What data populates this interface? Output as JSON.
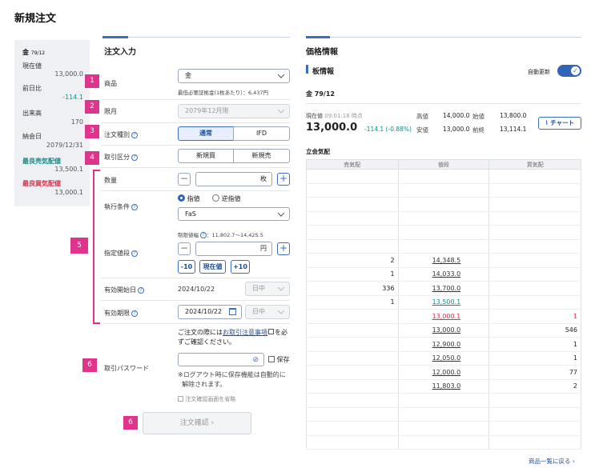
{
  "page_title": "新規注文",
  "summary": {
    "product": "金",
    "product_month": "79/12",
    "rows": [
      {
        "label": "現在値",
        "value": "13,000.0"
      },
      {
        "label": "前日比",
        "value": "-114.1"
      },
      {
        "label": "出来高",
        "value": "170"
      },
      {
        "label": "納会日",
        "value": "2079/12/31"
      },
      {
        "label": "最良売気配値",
        "value": "13,500.1"
      },
      {
        "label": "最良買気配値",
        "value": "13,000.1"
      }
    ]
  },
  "order_form": {
    "section_title": "注文入力",
    "product_label": "商品",
    "product_value": "金",
    "margin_note": "最低必要証拠金(1枚あたり）：6,437円",
    "month_label": "限月",
    "month_value": "2079年12月限",
    "order_type_label": "注文種別",
    "order_type_options": [
      "通常",
      "IFD"
    ],
    "trade_type_label": "取引区分",
    "trade_type_options": [
      "新規買",
      "新規売"
    ],
    "quantity_label": "数量",
    "quantity_unit": "枚",
    "exec_label": "執行条件",
    "exec_radio_1": "指値",
    "exec_radio_2": "逆指値",
    "exec_select": "FaS",
    "limit_range": "制限値幅",
    "limit_range_value": "：11,802.7〜14,425.5",
    "price_label": "指定値段",
    "price_unit": "円",
    "tick_minus": "-10",
    "tick_current": "現在値",
    "tick_plus": "+10",
    "start_label": "有効開始日",
    "start_date": "2024/10/22",
    "start_session": "日中",
    "end_label": "有効期限",
    "end_date": "2024/10/22",
    "end_session": "日中",
    "notice_pre": "ご注文の際には",
    "notice_link": "お取引注意事項",
    "notice_post": "を必",
    "notice_line2": "ずご確認ください。",
    "password_label": "取引パスワード",
    "save_label": "保存",
    "logout_note_1": "※ログアウト時に保存機能は自動的に",
    "logout_note_2": "解除されます。",
    "skip_confirm": "注文確認画面を省略",
    "confirm_button": "注文確認",
    "markers": [
      "1",
      "2",
      "3",
      "4",
      "5",
      "6",
      "6"
    ]
  },
  "price_info": {
    "section_title": "価格情報",
    "board_title": "板情報",
    "auto_update": "自動更新",
    "product": "金 79/12",
    "current_label": "現在値",
    "current_time": "09:01:18 時点",
    "current_price": "13,000.0",
    "change": "-114.1 (-0.88%)",
    "high_label": "高値",
    "high": "14,000.0",
    "open_label": "始値",
    "open": "13,800.0",
    "low_label": "安値",
    "low": "13,000.0",
    "prev_label": "前終",
    "prev": "13,114.1",
    "chart_button": "チャート",
    "auction_title": "立会気配",
    "columns": [
      "売気配",
      "値段",
      "買気配"
    ],
    "book": [
      {
        "sell": "",
        "price": "",
        "buy": ""
      },
      {
        "sell": "",
        "price": "",
        "buy": ""
      },
      {
        "sell": "",
        "price": "",
        "buy": ""
      },
      {
        "sell": "",
        "price": "",
        "buy": ""
      },
      {
        "sell": "",
        "price": "",
        "buy": ""
      },
      {
        "sell": "",
        "price": "",
        "buy": ""
      },
      {
        "sell": "2",
        "price": "14,348.5",
        "buy": ""
      },
      {
        "sell": "1",
        "price": "14,033.0",
        "buy": ""
      },
      {
        "sell": "336",
        "price": "13,700.0",
        "buy": ""
      },
      {
        "sell": "1",
        "price": "13,500.1",
        "buy": ""
      },
      {
        "sell": "",
        "price": "13,000.1",
        "buy": "1"
      },
      {
        "sell": "",
        "price": "13,000.0",
        "buy": "546"
      },
      {
        "sell": "",
        "price": "12,900.0",
        "buy": "1"
      },
      {
        "sell": "",
        "price": "12,050.0",
        "buy": "1"
      },
      {
        "sell": "",
        "price": "12,000.0",
        "buy": "77"
      },
      {
        "sell": "",
        "price": "11,803.0",
        "buy": "2"
      },
      {
        "sell": "",
        "price": "",
        "buy": ""
      },
      {
        "sell": "",
        "price": "",
        "buy": ""
      },
      {
        "sell": "",
        "price": "",
        "buy": ""
      },
      {
        "sell": "",
        "price": "",
        "buy": ""
      }
    ],
    "back_link": "商品一覧に戻る"
  },
  "colors": {
    "accent": "#3a6ec2",
    "marker": "#e0338b",
    "down": "#168a87",
    "sell_best": "#168a87",
    "buy_best": "#d8304a"
  }
}
